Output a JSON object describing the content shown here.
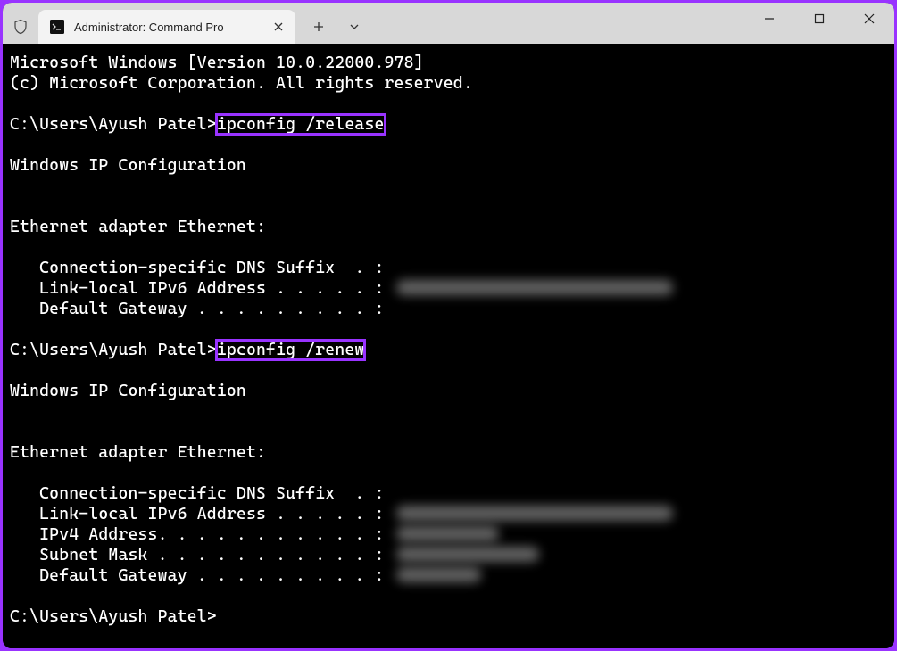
{
  "window": {
    "tab_title": "Administrator: Command Pro",
    "tab_icon": "terminal-icon"
  },
  "terminal": {
    "banner_line1": "Microsoft Windows [Version 10.0.22000.978]",
    "banner_line2": "(c) Microsoft Corporation. All rights reserved.",
    "prompt1_path": "C:\\Users\\Ayush Patel>",
    "prompt1_cmd": "ipconfig /release",
    "wic_header": "Windows IP Configuration",
    "eth_header": "Ethernet adapter Ethernet:",
    "dns_suffix_label": "   Connection-specific DNS Suffix  . :",
    "ll_ipv6_label": "   Link-local IPv6 Address . . . . . : ",
    "default_gw_label": "   Default Gateway . . . . . . . . . :",
    "prompt2_path": "C:\\Users\\Ayush Patel>",
    "prompt2_cmd": "ipconfig /renew",
    "wic_header2": "Windows IP Configuration",
    "eth_header2": "Ethernet adapter Ethernet:",
    "dns_suffix_label2": "   Connection-specific DNS Suffix  . :",
    "ll_ipv6_label2": "   Link-local IPv6 Address . . . . . : ",
    "ipv4_label": "   IPv4 Address. . . . . . . . . . . : ",
    "subnet_label": "   Subnet Mask . . . . . . . . . . . : ",
    "default_gw_label2": "   Default Gateway . . . . . . . . . : ",
    "prompt3_path": "C:\\Users\\Ayush Patel>"
  }
}
